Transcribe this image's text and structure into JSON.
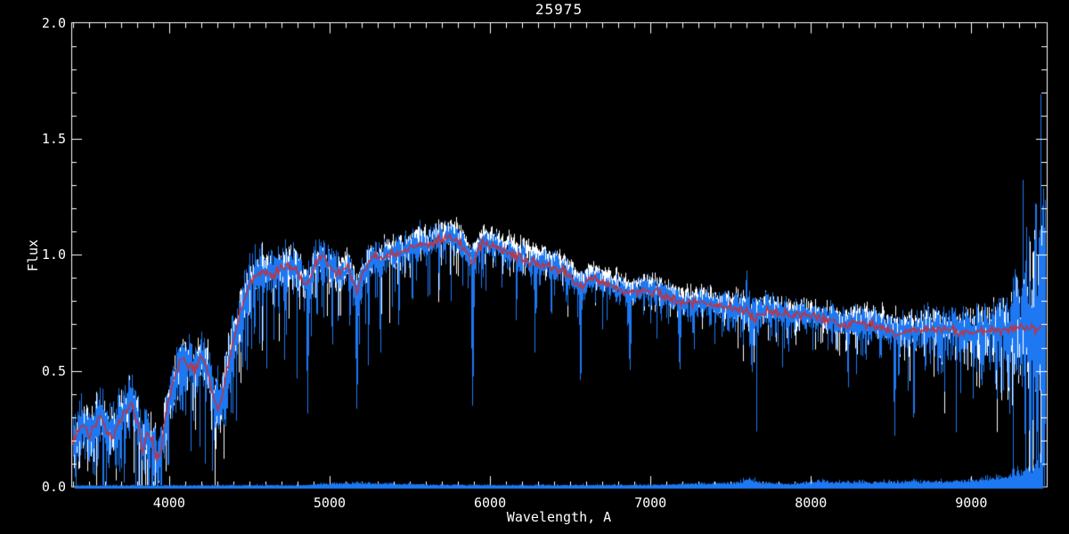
{
  "title": "25975",
  "axes": {
    "xlabel": "Wavelength, A",
    "ylabel": "Flux",
    "x_ticks": [
      4000,
      5000,
      6000,
      7000,
      8000,
      9000
    ],
    "y_ticks": [
      {
        "value": 0.0,
        "label": "0.0"
      },
      {
        "value": 0.5,
        "label": "0.5"
      },
      {
        "value": 1.0,
        "label": "1.0"
      },
      {
        "value": 1.5,
        "label": "1.5"
      },
      {
        "value": 2.0,
        "label": "2.0"
      }
    ],
    "x_minor_step": 100,
    "y_minor_step": 0.1
  },
  "colors": {
    "background": "#000000",
    "axis": "#ffffff",
    "observed": "#1d78f2",
    "comparison": "#ffffff",
    "template": "#d42c2c"
  },
  "chart_data": {
    "type": "line",
    "title": "25975",
    "xlabel": "Wavelength, A",
    "ylabel": "Flux",
    "xlim": [
      3390,
      9470
    ],
    "ylim": [
      0.0,
      2.0
    ],
    "grid": false,
    "legend": "none",
    "series": [
      {
        "name": "comparison-spectrum",
        "color": "#ffffff",
        "style": "noisy-line"
      },
      {
        "name": "observed-spectrum",
        "color": "#1d78f2",
        "style": "noisy-line"
      },
      {
        "name": "error-spectrum",
        "color": "#1d78f2",
        "style": "noisy-line-near-zero"
      },
      {
        "name": "template-fit",
        "color": "#d42c2c",
        "style": "smooth-line"
      }
    ],
    "template_points": [
      [
        3390,
        0.17
      ],
      [
        3430,
        0.24
      ],
      [
        3460,
        0.27
      ],
      [
        3500,
        0.22
      ],
      [
        3540,
        0.26
      ],
      [
        3570,
        0.31
      ],
      [
        3610,
        0.24
      ],
      [
        3650,
        0.22
      ],
      [
        3690,
        0.28
      ],
      [
        3730,
        0.33
      ],
      [
        3770,
        0.37
      ],
      [
        3810,
        0.25
      ],
      [
        3835,
        0.15
      ],
      [
        3865,
        0.24
      ],
      [
        3895,
        0.2
      ],
      [
        3920,
        0.11
      ],
      [
        3950,
        0.16
      ],
      [
        3975,
        0.3
      ],
      [
        4000,
        0.38
      ],
      [
        4040,
        0.5
      ],
      [
        4080,
        0.55
      ],
      [
        4120,
        0.52
      ],
      [
        4160,
        0.5
      ],
      [
        4200,
        0.56
      ],
      [
        4240,
        0.5
      ],
      [
        4280,
        0.38
      ],
      [
        4310,
        0.33
      ],
      [
        4350,
        0.46
      ],
      [
        4400,
        0.63
      ],
      [
        4450,
        0.77
      ],
      [
        4500,
        0.87
      ],
      [
        4550,
        0.92
      ],
      [
        4600,
        0.93
      ],
      [
        4650,
        0.91
      ],
      [
        4700,
        0.94
      ],
      [
        4750,
        0.96
      ],
      [
        4800,
        0.93
      ],
      [
        4861,
        0.86
      ],
      [
        4910,
        0.96
      ],
      [
        4960,
        0.99
      ],
      [
        5000,
        0.96
      ],
      [
        5050,
        0.91
      ],
      [
        5110,
        0.96
      ],
      [
        5168,
        0.84
      ],
      [
        5210,
        0.92
      ],
      [
        5260,
        0.99
      ],
      [
        5320,
        0.98
      ],
      [
        5380,
        1.0
      ],
      [
        5440,
        1.01
      ],
      [
        5500,
        1.03
      ],
      [
        5560,
        1.05
      ],
      [
        5620,
        1.04
      ],
      [
        5680,
        1.06
      ],
      [
        5740,
        1.07
      ],
      [
        5800,
        1.06
      ],
      [
        5890,
        0.97
      ],
      [
        5950,
        1.05
      ],
      [
        6010,
        1.04
      ],
      [
        6080,
        1.02
      ],
      [
        6150,
        1.0
      ],
      [
        6220,
        0.98
      ],
      [
        6290,
        0.96
      ],
      [
        6360,
        0.95
      ],
      [
        6430,
        0.94
      ],
      [
        6500,
        0.91
      ],
      [
        6563,
        0.85
      ],
      [
        6620,
        0.9
      ],
      [
        6700,
        0.88
      ],
      [
        6780,
        0.86
      ],
      [
        6870,
        0.83
      ],
      [
        6950,
        0.85
      ],
      [
        7030,
        0.84
      ],
      [
        7110,
        0.82
      ],
      [
        7190,
        0.79
      ],
      [
        7270,
        0.8
      ],
      [
        7350,
        0.79
      ],
      [
        7430,
        0.78
      ],
      [
        7510,
        0.77
      ],
      [
        7590,
        0.75
      ],
      [
        7650,
        0.73
      ],
      [
        7720,
        0.76
      ],
      [
        7800,
        0.75
      ],
      [
        7880,
        0.74
      ],
      [
        7960,
        0.74
      ],
      [
        8040,
        0.73
      ],
      [
        8120,
        0.72
      ],
      [
        8200,
        0.7
      ],
      [
        8280,
        0.71
      ],
      [
        8360,
        0.7
      ],
      [
        8440,
        0.69
      ],
      [
        8520,
        0.66
      ],
      [
        8600,
        0.67
      ],
      [
        8680,
        0.67
      ],
      [
        8760,
        0.68
      ],
      [
        8840,
        0.67
      ],
      [
        8920,
        0.67
      ],
      [
        9000,
        0.67
      ],
      [
        9100,
        0.67
      ],
      [
        9200,
        0.68
      ],
      [
        9300,
        0.68
      ],
      [
        9400,
        0.69
      ],
      [
        9470,
        0.7
      ]
    ],
    "absorption_features": [
      [
        3933,
        12,
        0.05
      ],
      [
        3968,
        10,
        0.1
      ],
      [
        4101,
        10,
        0.33
      ],
      [
        4172,
        8,
        0.38
      ],
      [
        4227,
        8,
        0.34
      ],
      [
        4305,
        16,
        0.24
      ],
      [
        4340,
        10,
        0.3
      ],
      [
        4383,
        9,
        0.35
      ],
      [
        4455,
        8,
        0.5
      ],
      [
        4530,
        8,
        0.62
      ],
      [
        4861,
        10,
        0.33
      ],
      [
        4920,
        7,
        0.68
      ],
      [
        5015,
        7,
        0.7
      ],
      [
        5168,
        12,
        0.33
      ],
      [
        5240,
        8,
        0.5
      ],
      [
        5315,
        8,
        0.54
      ],
      [
        5430,
        7,
        0.65
      ],
      [
        5890,
        12,
        0.36
      ],
      [
        6162,
        7,
        0.68
      ],
      [
        6278,
        8,
        0.58
      ],
      [
        6380,
        7,
        0.7
      ],
      [
        6563,
        10,
        0.42
      ],
      [
        6700,
        6,
        0.68
      ],
      [
        6870,
        13,
        0.5
      ],
      [
        7000,
        7,
        0.68
      ],
      [
        7180,
        12,
        0.48
      ],
      [
        7270,
        8,
        0.58
      ],
      [
        7400,
        6,
        0.62
      ],
      [
        7630,
        15,
        0.5
      ],
      [
        7660,
        5,
        0.26
      ],
      [
        8010,
        7,
        0.6
      ],
      [
        8130,
        7,
        0.58
      ],
      [
        8230,
        10,
        0.44
      ],
      [
        8320,
        6,
        0.58
      ],
      [
        8430,
        6,
        0.56
      ],
      [
        8520,
        10,
        0.2
      ],
      [
        8545,
        6,
        0.4
      ],
      [
        8640,
        9,
        0.23
      ],
      [
        8710,
        6,
        0.5
      ],
      [
        8790,
        8,
        0.45
      ],
      [
        8870,
        6,
        0.55
      ],
      [
        8940,
        6,
        0.55
      ],
      [
        9015,
        7,
        0.5
      ],
      [
        9060,
        7,
        0.45
      ],
      [
        9150,
        7,
        0.42
      ],
      [
        9220,
        6,
        0.5
      ]
    ],
    "emission_spikes": [
      [
        7597,
        0.97,
        30
      ],
      [
        9320,
        1.33,
        10
      ],
      [
        9360,
        1.18,
        8
      ],
      [
        9400,
        1.45,
        9
      ],
      [
        9432,
        1.84,
        7
      ],
      [
        9450,
        1.62,
        7
      ],
      [
        9462,
        1.3,
        6
      ]
    ],
    "error_points": [
      [
        3390,
        0.004
      ],
      [
        4800,
        0.005
      ],
      [
        4950,
        0.009
      ],
      [
        5150,
        0.012
      ],
      [
        5300,
        0.011
      ],
      [
        5450,
        0.009
      ],
      [
        5600,
        0.006
      ],
      [
        6300,
        0.005
      ],
      [
        7000,
        0.006
      ],
      [
        7540,
        0.012
      ],
      [
        7620,
        0.022
      ],
      [
        7700,
        0.012
      ],
      [
        7900,
        0.008
      ],
      [
        8050,
        0.014
      ],
      [
        8200,
        0.012
      ],
      [
        8400,
        0.012
      ],
      [
        8600,
        0.013
      ],
      [
        8800,
        0.015
      ],
      [
        9000,
        0.018
      ],
      [
        9150,
        0.025
      ],
      [
        9300,
        0.038
      ],
      [
        9420,
        0.055
      ],
      [
        9470,
        0.05
      ]
    ]
  },
  "render": {
    "seed": 77,
    "samples_per_column": 4,
    "noise_sigma": [
      [
        3390,
        0.055
      ],
      [
        3900,
        0.06
      ],
      [
        4100,
        0.05
      ],
      [
        4300,
        0.065
      ],
      [
        4600,
        0.05
      ],
      [
        5000,
        0.042
      ],
      [
        5500,
        0.035
      ],
      [
        6000,
        0.03
      ],
      [
        6500,
        0.028
      ],
      [
        7000,
        0.026
      ],
      [
        7400,
        0.03
      ],
      [
        7600,
        0.04
      ],
      [
        8000,
        0.028
      ],
      [
        8400,
        0.035
      ],
      [
        8700,
        0.045
      ],
      [
        9000,
        0.05
      ],
      [
        9200,
        0.07
      ],
      [
        9300,
        0.12
      ],
      [
        9380,
        0.22
      ],
      [
        9470,
        0.28
      ]
    ],
    "spike_prob": [
      [
        3390,
        0.25
      ],
      [
        4200,
        0.3
      ],
      [
        4800,
        0.28
      ],
      [
        5600,
        0.22
      ],
      [
        6300,
        0.18
      ],
      [
        7000,
        0.15
      ],
      [
        7600,
        0.22
      ],
      [
        8200,
        0.2
      ],
      [
        8800,
        0.25
      ],
      [
        9470,
        0.3
      ]
    ],
    "spike_depth": [
      [
        3390,
        2.2
      ],
      [
        4300,
        3.2
      ],
      [
        5200,
        3.0
      ],
      [
        6000,
        2.6
      ],
      [
        7000,
        2.2
      ],
      [
        8000,
        2.4
      ],
      [
        8600,
        3.2
      ],
      [
        9470,
        2.2
      ]
    ],
    "white_offset": [
      [
        3390,
        0.0
      ],
      [
        5300,
        0.005
      ],
      [
        5600,
        0.02
      ],
      [
        5900,
        0.03
      ],
      [
        6200,
        0.035
      ],
      [
        6600,
        0.03
      ],
      [
        7000,
        0.025
      ],
      [
        7300,
        0.02
      ],
      [
        7600,
        0.008
      ],
      [
        7900,
        0.012
      ],
      [
        8300,
        0.02
      ],
      [
        8700,
        0.022
      ],
      [
        9000,
        0.012
      ],
      [
        9470,
        0.0
      ]
    ]
  }
}
